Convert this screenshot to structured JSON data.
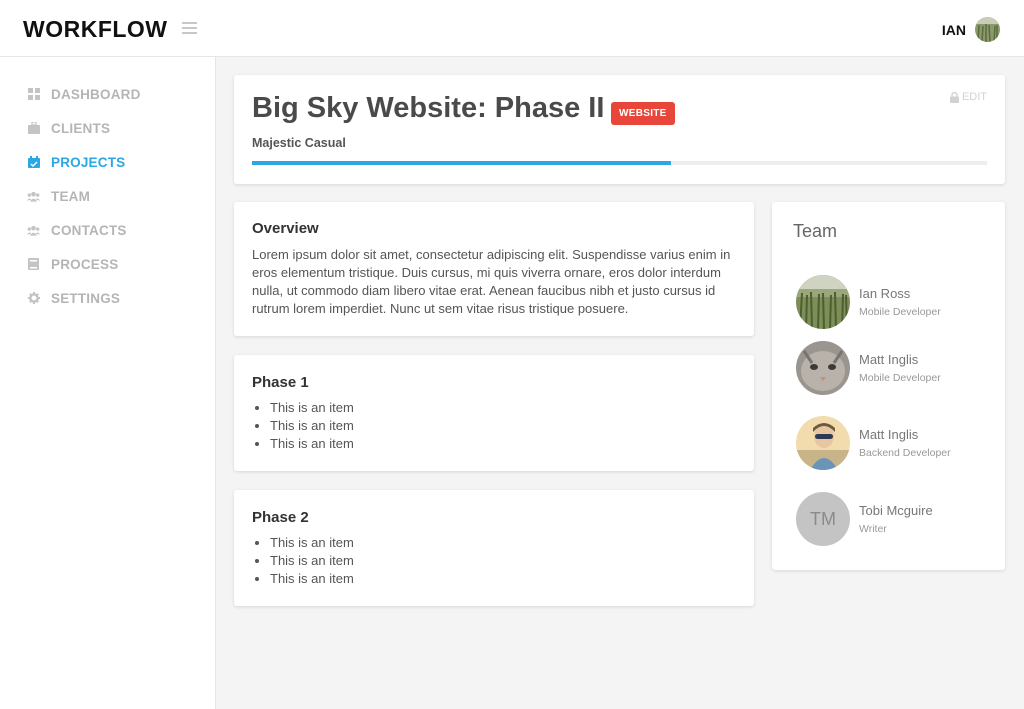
{
  "app": {
    "logo": "WORKFLOW"
  },
  "user": {
    "name": "IAN",
    "avatar_icon": "wheat-field-photo"
  },
  "sidebar": {
    "items": [
      {
        "label": "DASHBOARD",
        "icon": "grid-icon",
        "active": false
      },
      {
        "label": "CLIENTS",
        "icon": "briefcase-icon",
        "active": false
      },
      {
        "label": "PROJECTS",
        "icon": "calendar-icon",
        "active": true
      },
      {
        "label": "TEAM",
        "icon": "users-icon",
        "active": false
      },
      {
        "label": "CONTACTS",
        "icon": "users-icon",
        "active": false
      },
      {
        "label": "PROCESS",
        "icon": "book-icon",
        "active": false
      },
      {
        "label": "SETTINGS",
        "icon": "gear-icon",
        "active": false
      }
    ]
  },
  "project": {
    "title": "Big Sky Website: Phase II",
    "badge": "WEBSITE",
    "client": "Majestic Casual",
    "progress": 0.57,
    "edit_label": "EDIT"
  },
  "overview": {
    "title": "Overview",
    "text": "Lorem ipsum dolor sit amet, consectetur adipiscing elit. Suspendisse varius enim in eros elementum tristique. Duis cursus, mi quis viverra ornare, eros dolor interdum nulla, ut commodo diam libero vitae erat. Aenean faucibus nibh et justo cursus id rutrum lorem imperdiet. Nunc ut sem vitae risus tristique posuere."
  },
  "phases": [
    {
      "title": "Phase 1",
      "items": [
        "This is an item",
        "This is an item",
        "This is an item"
      ]
    },
    {
      "title": "Phase 2",
      "items": [
        "This is an item",
        "This is an item",
        "This is an item"
      ]
    }
  ],
  "team": {
    "title": "Team",
    "members": [
      {
        "name": "Ian Ross",
        "role": "Mobile Developer",
        "avatar": "wheat-field-photo"
      },
      {
        "name": "Matt Inglis",
        "role": "Mobile Developer",
        "avatar": "cat-photo"
      },
      {
        "name": "Matt Inglis",
        "role": "Backend Developer",
        "avatar": "person-sunglasses-photo"
      },
      {
        "name": "Tobi Mcguire",
        "role": "Writer",
        "initials": "TM"
      }
    ]
  },
  "colors": {
    "accent": "#2aa7e4",
    "badge": "#e8463a"
  }
}
